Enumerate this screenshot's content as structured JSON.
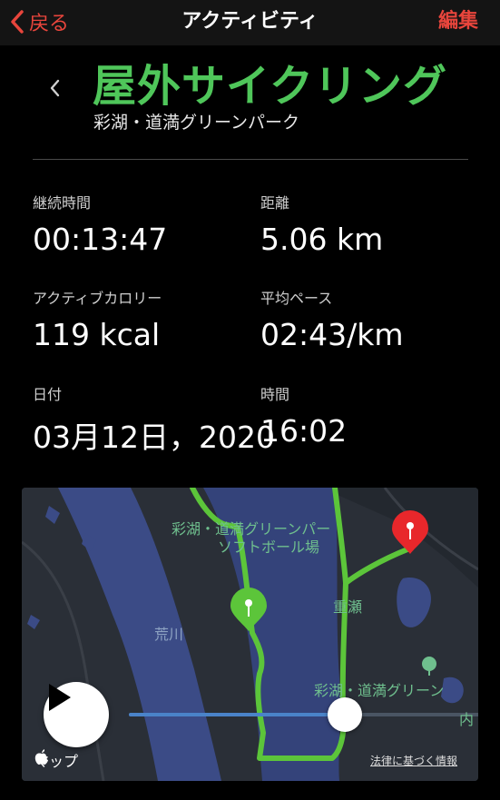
{
  "nav": {
    "back_label": "戻る",
    "title": "アクティビティ",
    "edit_label": "編集"
  },
  "header": {
    "activity_title": "屋外サイクリング",
    "location": "彩湖・道満グリーンパーク"
  },
  "stats": {
    "duration": {
      "label": "継続時間",
      "value": "00:13:47"
    },
    "distance": {
      "label": "距離",
      "value": "5.06 km"
    },
    "calories": {
      "label": "アクティブカロリー",
      "value": "119 kcal"
    },
    "pace": {
      "label": "平均ペース",
      "value": "02:43/km"
    },
    "date": {
      "label": "日付",
      "value": "03月12日，2020"
    },
    "time": {
      "label": "時間",
      "value": "16:02"
    }
  },
  "map": {
    "labels": {
      "park_line1": "彩湖・道満グリーンパー",
      "park_line2": "ソフトボール場",
      "place": "重瀬",
      "river": "荒川",
      "park_bottom": "彩湖・道満グリーン",
      "edge": "内"
    },
    "brand": "マップ",
    "legal": "法律に基づく情報",
    "playback_progress": 0.71,
    "colors": {
      "route": "#5cc53a",
      "start_pin": "#5cc53a",
      "end_pin": "#e8272b",
      "water": "#3b4b86"
    }
  },
  "colors": {
    "accent": "#e8453c",
    "title_green": "#4fc65a"
  },
  "icons": {
    "back": "chevron-left-icon",
    "play": "play-icon",
    "pin": "map-pin-icon",
    "apple": "apple-icon"
  }
}
